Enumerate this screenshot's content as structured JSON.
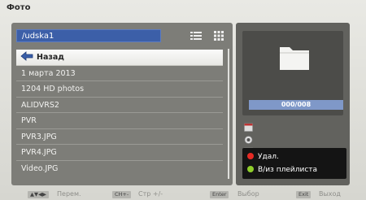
{
  "window": {
    "title": "Фото"
  },
  "path": {
    "value": "/udska1"
  },
  "file_list": {
    "items": [
      {
        "label": "Назад",
        "selected": true
      },
      {
        "label": "1 марта 2013"
      },
      {
        "label": "1204 HD photos"
      },
      {
        "label": "ALIDVRS2"
      },
      {
        "label": "PVR"
      },
      {
        "label": "PVR3.JPG"
      },
      {
        "label": "PVR4.JPG"
      },
      {
        "label": "Video.JPG"
      }
    ]
  },
  "preview": {
    "counter": "000/008"
  },
  "legend": {
    "red_label": "Удал.",
    "green_label": "В/из плейлиста",
    "red_color": "#e52a24",
    "green_color": "#8fce2a"
  },
  "footer": {
    "nav_key": "▲▼◀▶",
    "nav_label": "Перем.",
    "ch_key": "CH+-",
    "ch_label": "Стр +/-",
    "enter_key": "Enter",
    "enter_label": "Выбор",
    "exit_key": "Exit",
    "exit_label": "Выход"
  }
}
